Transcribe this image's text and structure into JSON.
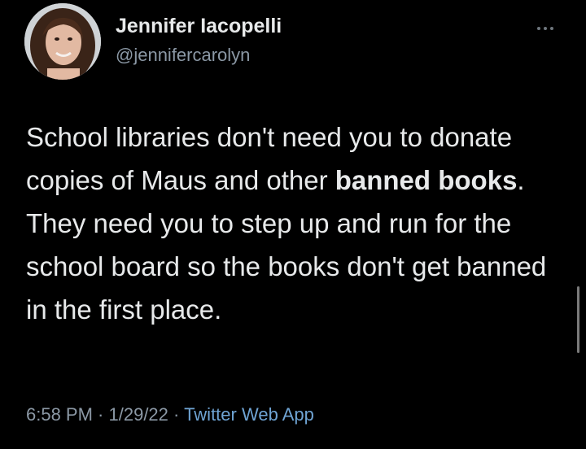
{
  "author": {
    "name": "Jennifer Iacopelli",
    "handle": "@jennifercarolyn",
    "avatar_icon": "profile-photo"
  },
  "tweet": {
    "text_before": "School libraries don't need you to donate copies of Maus and other ",
    "text_bold": "banned books",
    "text_after": ". They need you to step up and run for the school board so the books don't get banned in the first place."
  },
  "meta": {
    "time": "6:58 PM",
    "separator": " · ",
    "date": "1/29/22",
    "source": "Twitter Web App"
  },
  "colors": {
    "background": "#000000",
    "text": "#e7e9ea",
    "secondary": "#8b98a5",
    "link": "#6fa4d4"
  },
  "icons": {
    "more": "more-horizontal-icon"
  }
}
